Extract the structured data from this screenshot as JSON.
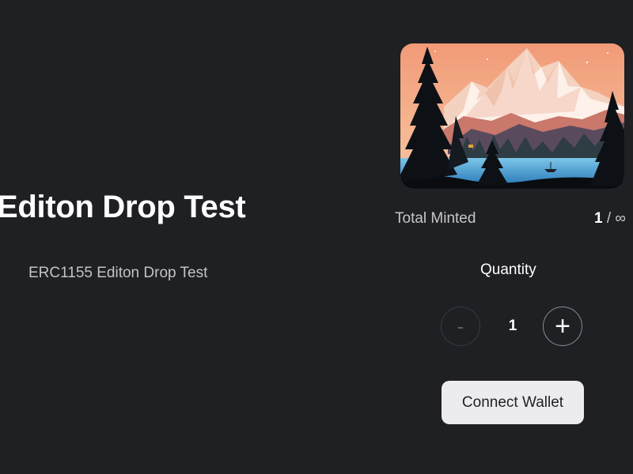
{
  "drop": {
    "title": "Editon Drop Test",
    "description": "ERC1155 Editon Drop Test"
  },
  "artwork": {
    "icon": "mountain-lake-illustration"
  },
  "stats": {
    "total_minted_label": "Total Minted",
    "minted_count": "1",
    "separator": " / ",
    "max_supply": "∞"
  },
  "quantity": {
    "label": "Quantity",
    "value": "1",
    "decrement_label": "-",
    "increment_label": "+"
  },
  "actions": {
    "connect_wallet_label": "Connect Wallet"
  },
  "colors": {
    "background": "#1f2024",
    "button_bg": "#ececee",
    "text": "#ffffff"
  }
}
